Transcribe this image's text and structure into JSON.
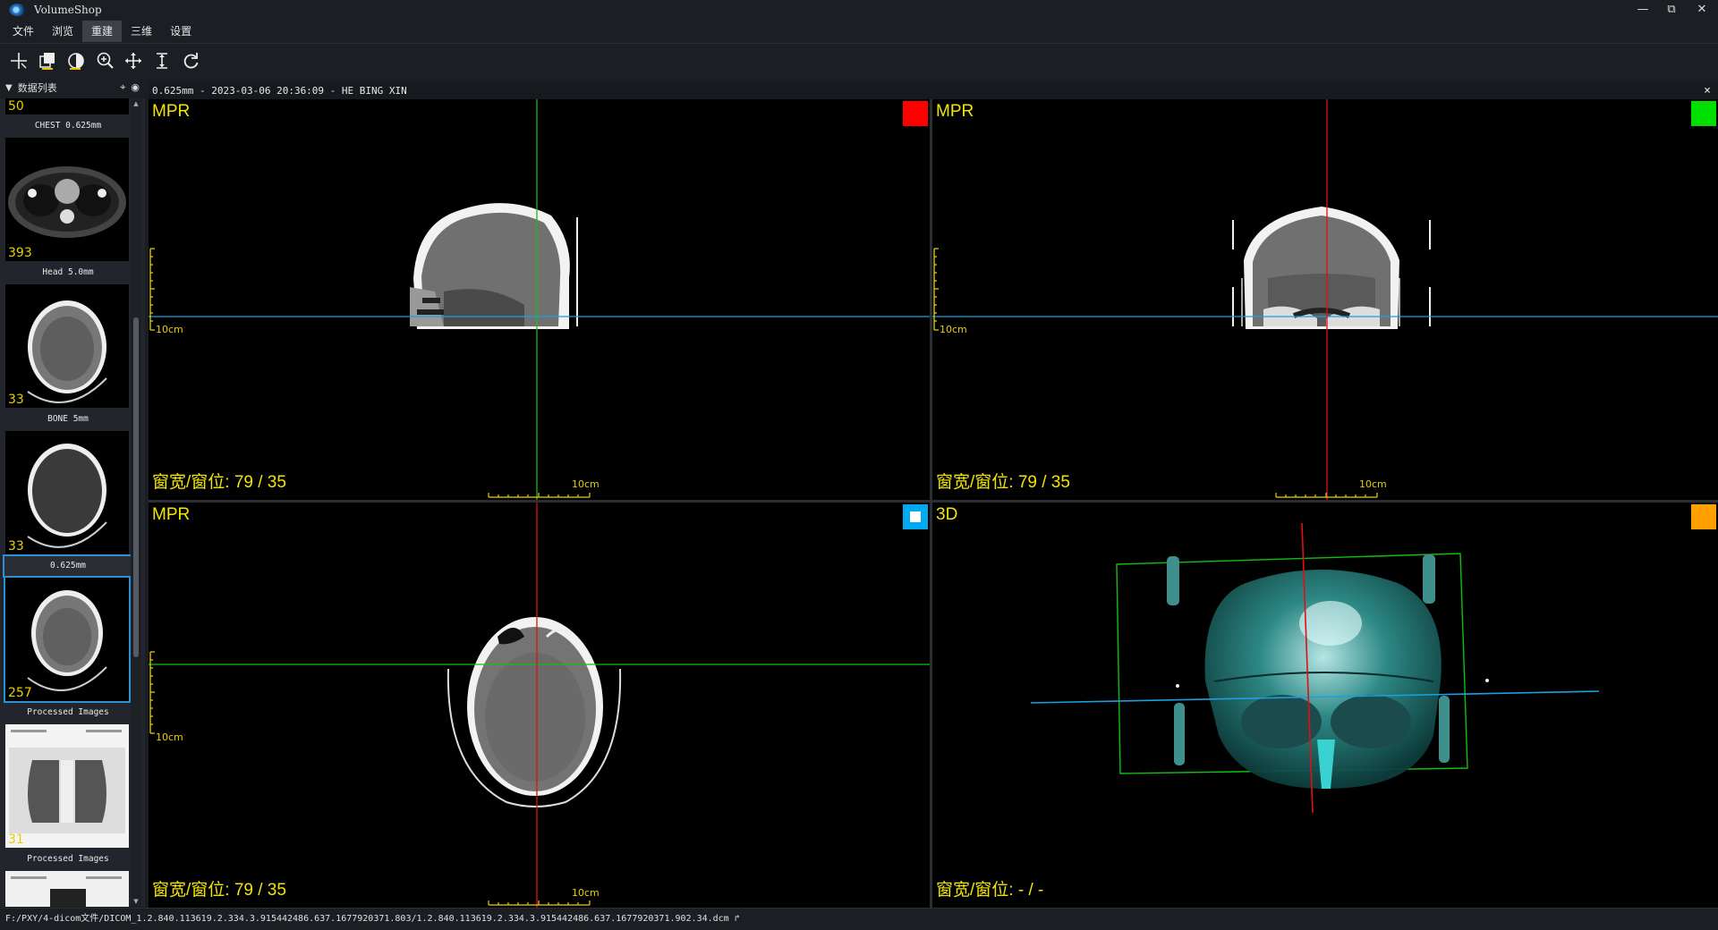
{
  "app": {
    "title": "VolumeShop"
  },
  "window_controls": {
    "minimize": "—",
    "maximize": "⧉",
    "close": "✕"
  },
  "menu": {
    "items": [
      "文件",
      "浏览",
      "重建",
      "三维",
      "设置"
    ],
    "active_index": 2
  },
  "toolbar": {
    "tools": [
      "crosshair-tool-icon",
      "layers-tool-icon",
      "window-level-tool-icon",
      "zoom-tool-icon",
      "pan-tool-icon",
      "slice-thickness-tool-icon",
      "reset-tool-icon"
    ]
  },
  "sidebar": {
    "title": "数据列表",
    "top_count": "50",
    "series": [
      {
        "label": "CHEST 0.625mm",
        "count": "393",
        "kind": "chest"
      },
      {
        "label": "Head 5.0mm",
        "count": "33",
        "kind": "head"
      },
      {
        "label": "BONE 5mm",
        "count": "33",
        "kind": "bone"
      },
      {
        "label": "0.625mm",
        "count": "257",
        "kind": "head",
        "selected": true
      },
      {
        "label": "Processed Images",
        "count": "31",
        "kind": "processed"
      },
      {
        "label": "Processed Images",
        "count": "",
        "kind": "processed"
      }
    ]
  },
  "view_header": {
    "text": "0.625mm - 2023-03-06 20:36:09 - HE BING XIN",
    "close": "×"
  },
  "viewports": {
    "sagittal": {
      "title": "MPR",
      "window_level": "窗宽/窗位: 79 / 35",
      "scale_left": "10cm",
      "scale_bottom": "10cm",
      "badge_color": "#ff0000"
    },
    "coronal": {
      "title": "MPR",
      "window_level": "窗宽/窗位: 79 / 35",
      "scale_left": "10cm",
      "scale_bottom": "10cm",
      "badge_color": "#00e000"
    },
    "axial": {
      "title": "MPR",
      "window_level": "窗宽/窗位: 79 / 35",
      "scale_left": "10cm",
      "scale_bottom": "10cm",
      "badge_color": "#00aaf0"
    },
    "volume3d": {
      "title": "3D",
      "window_level": "窗宽/窗位: - / -",
      "badge_color": "#ffa000"
    }
  },
  "colors": {
    "accent_red": "#e01010",
    "accent_green": "#10c010",
    "accent_blue": "#1aa0e0",
    "label_yellow": "#f2e600"
  },
  "status": {
    "path": "F:/PXY/4-dicom文件/DICOM_1.2.840.113619.2.334.3.915442486.637.1677920371.803/1.2.840.113619.2.334.3.915442486.637.1677920371.902.34.dcm  ↱"
  }
}
